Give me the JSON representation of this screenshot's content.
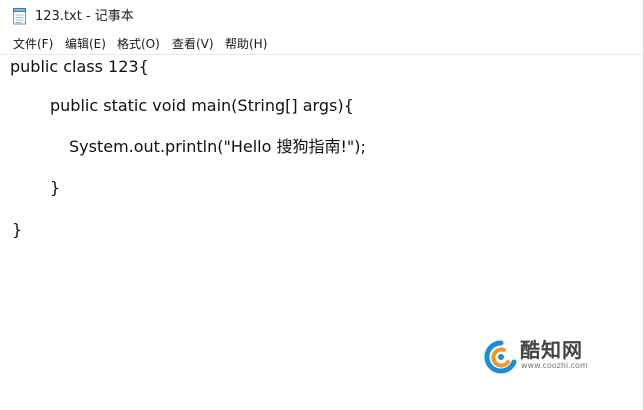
{
  "window": {
    "title": "123.txt - 记事本",
    "icon": "notepad-icon"
  },
  "menu": {
    "items": [
      {
        "label": "文件(F)"
      },
      {
        "label": "编辑(E)"
      },
      {
        "label": "格式(O)"
      },
      {
        "label": "查看(V)"
      },
      {
        "label": "帮助(H)"
      }
    ]
  },
  "editor": {
    "lines": [
      "public class 123{",
      "public static void main(String[] args){",
      "System.out.println(\"Hello 搜狗指南!\");",
      "}",
      "}"
    ]
  },
  "watermark": {
    "name": "酷知网",
    "url": "www.coozhi.com",
    "logo_icon": "coozhi-logo-icon",
    "logo_colors": [
      "#1a8fd8",
      "#f29a1e"
    ]
  }
}
